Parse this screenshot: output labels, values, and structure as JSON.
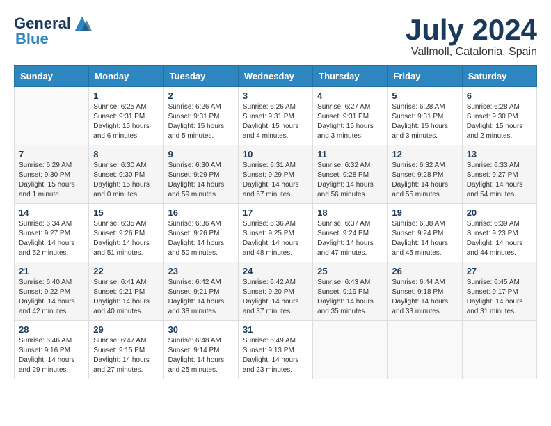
{
  "header": {
    "logo_line1": "General",
    "logo_line2": "Blue",
    "title": "July 2024",
    "subtitle": "Vallmoll, Catalonia, Spain"
  },
  "weekdays": [
    "Sunday",
    "Monday",
    "Tuesday",
    "Wednesday",
    "Thursday",
    "Friday",
    "Saturday"
  ],
  "weeks": [
    [
      {
        "day": "",
        "sunrise": "",
        "sunset": "",
        "daylight": ""
      },
      {
        "day": "1",
        "sunrise": "Sunrise: 6:25 AM",
        "sunset": "Sunset: 9:31 PM",
        "daylight": "Daylight: 15 hours and 6 minutes."
      },
      {
        "day": "2",
        "sunrise": "Sunrise: 6:26 AM",
        "sunset": "Sunset: 9:31 PM",
        "daylight": "Daylight: 15 hours and 5 minutes."
      },
      {
        "day": "3",
        "sunrise": "Sunrise: 6:26 AM",
        "sunset": "Sunset: 9:31 PM",
        "daylight": "Daylight: 15 hours and 4 minutes."
      },
      {
        "day": "4",
        "sunrise": "Sunrise: 6:27 AM",
        "sunset": "Sunset: 9:31 PM",
        "daylight": "Daylight: 15 hours and 3 minutes."
      },
      {
        "day": "5",
        "sunrise": "Sunrise: 6:28 AM",
        "sunset": "Sunset: 9:31 PM",
        "daylight": "Daylight: 15 hours and 3 minutes."
      },
      {
        "day": "6",
        "sunrise": "Sunrise: 6:28 AM",
        "sunset": "Sunset: 9:30 PM",
        "daylight": "Daylight: 15 hours and 2 minutes."
      }
    ],
    [
      {
        "day": "7",
        "sunrise": "Sunrise: 6:29 AM",
        "sunset": "Sunset: 9:30 PM",
        "daylight": "Daylight: 15 hours and 1 minute."
      },
      {
        "day": "8",
        "sunrise": "Sunrise: 6:30 AM",
        "sunset": "Sunset: 9:30 PM",
        "daylight": "Daylight: 15 hours and 0 minutes."
      },
      {
        "day": "9",
        "sunrise": "Sunrise: 6:30 AM",
        "sunset": "Sunset: 9:29 PM",
        "daylight": "Daylight: 14 hours and 59 minutes."
      },
      {
        "day": "10",
        "sunrise": "Sunrise: 6:31 AM",
        "sunset": "Sunset: 9:29 PM",
        "daylight": "Daylight: 14 hours and 57 minutes."
      },
      {
        "day": "11",
        "sunrise": "Sunrise: 6:32 AM",
        "sunset": "Sunset: 9:28 PM",
        "daylight": "Daylight: 14 hours and 56 minutes."
      },
      {
        "day": "12",
        "sunrise": "Sunrise: 6:32 AM",
        "sunset": "Sunset: 9:28 PM",
        "daylight": "Daylight: 14 hours and 55 minutes."
      },
      {
        "day": "13",
        "sunrise": "Sunrise: 6:33 AM",
        "sunset": "Sunset: 9:27 PM",
        "daylight": "Daylight: 14 hours and 54 minutes."
      }
    ],
    [
      {
        "day": "14",
        "sunrise": "Sunrise: 6:34 AM",
        "sunset": "Sunset: 9:27 PM",
        "daylight": "Daylight: 14 hours and 52 minutes."
      },
      {
        "day": "15",
        "sunrise": "Sunrise: 6:35 AM",
        "sunset": "Sunset: 9:26 PM",
        "daylight": "Daylight: 14 hours and 51 minutes."
      },
      {
        "day": "16",
        "sunrise": "Sunrise: 6:36 AM",
        "sunset": "Sunset: 9:26 PM",
        "daylight": "Daylight: 14 hours and 50 minutes."
      },
      {
        "day": "17",
        "sunrise": "Sunrise: 6:36 AM",
        "sunset": "Sunset: 9:25 PM",
        "daylight": "Daylight: 14 hours and 48 minutes."
      },
      {
        "day": "18",
        "sunrise": "Sunrise: 6:37 AM",
        "sunset": "Sunset: 9:24 PM",
        "daylight": "Daylight: 14 hours and 47 minutes."
      },
      {
        "day": "19",
        "sunrise": "Sunrise: 6:38 AM",
        "sunset": "Sunset: 9:24 PM",
        "daylight": "Daylight: 14 hours and 45 minutes."
      },
      {
        "day": "20",
        "sunrise": "Sunrise: 6:39 AM",
        "sunset": "Sunset: 9:23 PM",
        "daylight": "Daylight: 14 hours and 44 minutes."
      }
    ],
    [
      {
        "day": "21",
        "sunrise": "Sunrise: 6:40 AM",
        "sunset": "Sunset: 9:22 PM",
        "daylight": "Daylight: 14 hours and 42 minutes."
      },
      {
        "day": "22",
        "sunrise": "Sunrise: 6:41 AM",
        "sunset": "Sunset: 9:21 PM",
        "daylight": "Daylight: 14 hours and 40 minutes."
      },
      {
        "day": "23",
        "sunrise": "Sunrise: 6:42 AM",
        "sunset": "Sunset: 9:21 PM",
        "daylight": "Daylight: 14 hours and 38 minutes."
      },
      {
        "day": "24",
        "sunrise": "Sunrise: 6:42 AM",
        "sunset": "Sunset: 9:20 PM",
        "daylight": "Daylight: 14 hours and 37 minutes."
      },
      {
        "day": "25",
        "sunrise": "Sunrise: 6:43 AM",
        "sunset": "Sunset: 9:19 PM",
        "daylight": "Daylight: 14 hours and 35 minutes."
      },
      {
        "day": "26",
        "sunrise": "Sunrise: 6:44 AM",
        "sunset": "Sunset: 9:18 PM",
        "daylight": "Daylight: 14 hours and 33 minutes."
      },
      {
        "day": "27",
        "sunrise": "Sunrise: 6:45 AM",
        "sunset": "Sunset: 9:17 PM",
        "daylight": "Daylight: 14 hours and 31 minutes."
      }
    ],
    [
      {
        "day": "28",
        "sunrise": "Sunrise: 6:46 AM",
        "sunset": "Sunset: 9:16 PM",
        "daylight": "Daylight: 14 hours and 29 minutes."
      },
      {
        "day": "29",
        "sunrise": "Sunrise: 6:47 AM",
        "sunset": "Sunset: 9:15 PM",
        "daylight": "Daylight: 14 hours and 27 minutes."
      },
      {
        "day": "30",
        "sunrise": "Sunrise: 6:48 AM",
        "sunset": "Sunset: 9:14 PM",
        "daylight": "Daylight: 14 hours and 25 minutes."
      },
      {
        "day": "31",
        "sunrise": "Sunrise: 6:49 AM",
        "sunset": "Sunset: 9:13 PM",
        "daylight": "Daylight: 14 hours and 23 minutes."
      },
      {
        "day": "",
        "sunrise": "",
        "sunset": "",
        "daylight": ""
      },
      {
        "day": "",
        "sunrise": "",
        "sunset": "",
        "daylight": ""
      },
      {
        "day": "",
        "sunrise": "",
        "sunset": "",
        "daylight": ""
      }
    ]
  ]
}
